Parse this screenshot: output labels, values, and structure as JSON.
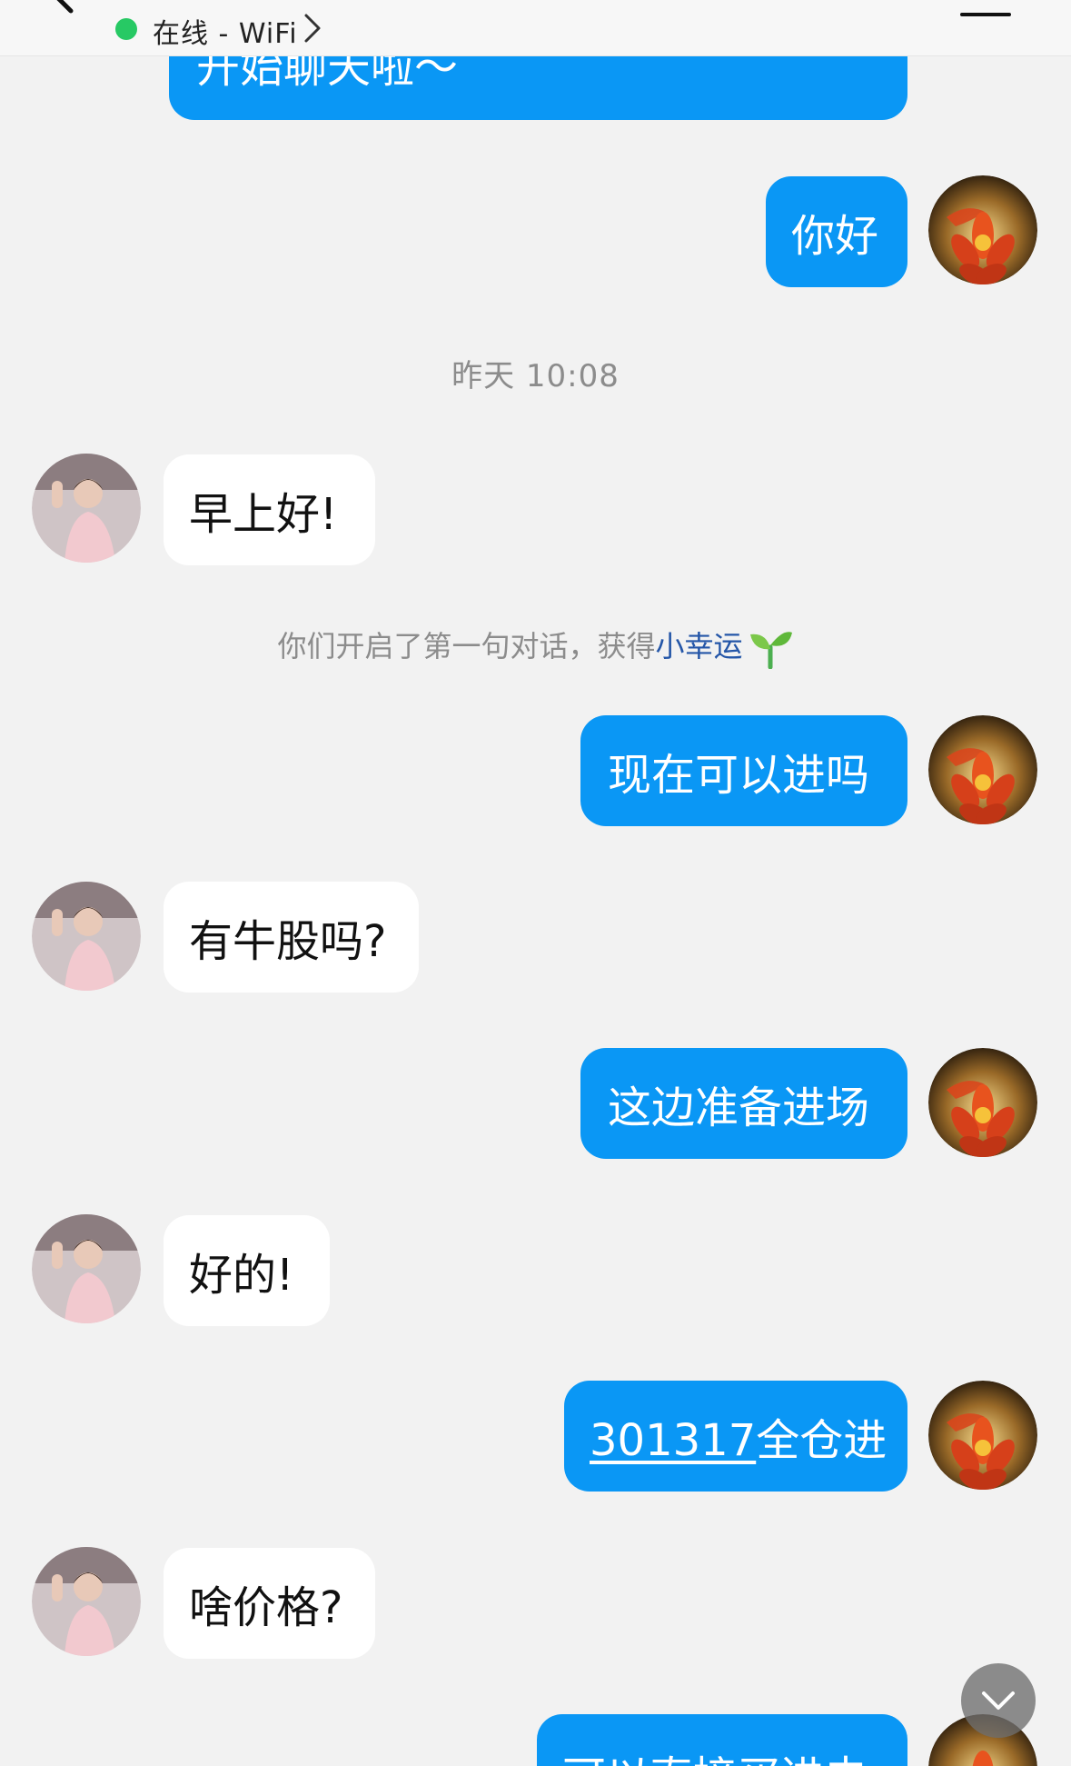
{
  "header": {
    "status_text": "在线 - WiFi",
    "status_color": "#27c964",
    "back_icon": "back-chevron-icon",
    "menu_icon": "hamburger-menu-icon"
  },
  "colors": {
    "outgoing_bubble": "#0a97f5",
    "incoming_bubble": "#ffffff",
    "background": "#f2f2f2"
  },
  "messages": [
    {
      "side": "right",
      "text": "开始聊天啦～",
      "partial": true
    },
    {
      "side": "right",
      "text": "你好"
    },
    {
      "type": "timestamp",
      "text": "昨天 10:08"
    },
    {
      "side": "left",
      "text": "早上好!"
    },
    {
      "type": "system",
      "text": "你们开启了第一句对话，获得",
      "highlight": "小幸运"
    },
    {
      "side": "right",
      "text": "现在可以进吗"
    },
    {
      "side": "left",
      "text": "有牛股吗?"
    },
    {
      "side": "right",
      "text": "这边准备进场"
    },
    {
      "side": "left",
      "text": "好的!"
    },
    {
      "side": "right",
      "link": "301317",
      "text": "全仓进"
    },
    {
      "side": "left",
      "text": "啥价格?"
    },
    {
      "side": "right",
      "text": "可以直接买进去",
      "partial": true
    }
  ],
  "scroll_button_icon": "chevron-down-icon"
}
